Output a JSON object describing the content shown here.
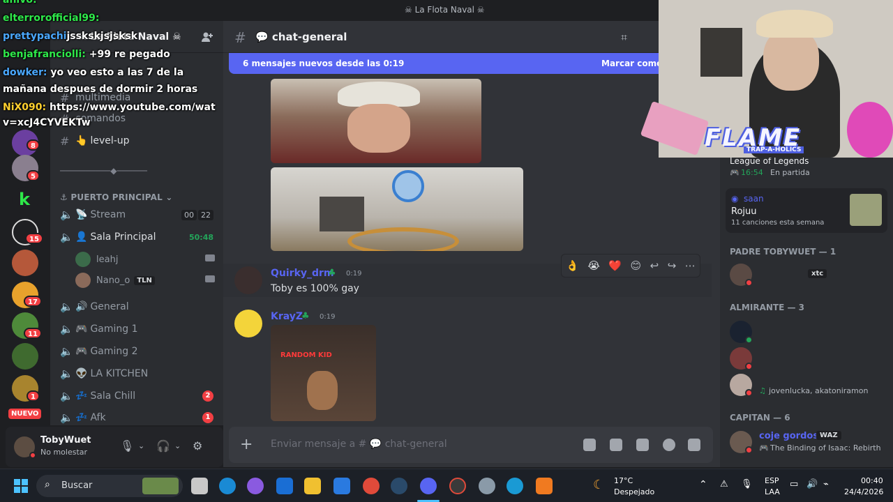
{
  "window": {
    "title": "☠ La Flota Naval ☠"
  },
  "server": {
    "name": "☠ La Flota Naval ☠"
  },
  "server_badges": [
    "8",
    "5",
    "15",
    "17",
    "11",
    "1"
  ],
  "server_nuevo": "NUEVO",
  "channels": [
    {
      "label": "multimedia"
    },
    {
      "label": "comandos"
    },
    {
      "emoji": "👆",
      "label": "level-up"
    }
  ],
  "divider_text": "──────────◆──────",
  "category_puerto": "PUERTO PRINCIPAL",
  "voice_channels": [
    {
      "emoji": "📡",
      "label": "Stream",
      "count_a": "00",
      "count_b": "22"
    },
    {
      "emoji": "👤",
      "label": "Sala Principal",
      "timer": "50:48"
    },
    {
      "emoji": "🔊",
      "label": "General"
    },
    {
      "emoji": "🎮",
      "label": "Gaming 1"
    },
    {
      "emoji": "🎮",
      "label": "Gaming 2"
    },
    {
      "emoji": "👽",
      "label": "LA KITCHEN"
    },
    {
      "emoji": "💤",
      "label": "Sala Chill",
      "badge": "2"
    },
    {
      "emoji": "💤",
      "label": "Afk",
      "badge": "1"
    }
  ],
  "voice_users": [
    {
      "name": "leahj"
    },
    {
      "name": "Nano_o",
      "tag": "TLN"
    }
  ],
  "user_panel": {
    "name": "TobyWuet",
    "status": "No molestar"
  },
  "chat": {
    "channel": "💬 chat-general",
    "new_messages": "6 mensajes nuevos desde las 0:19",
    "mark_read": "Marcar como l",
    "messages": [
      {
        "author": "Quirky_drm",
        "time": "0:19",
        "text": "Toby es 100% gay"
      },
      {
        "author": "KrayZ",
        "time": "0:19",
        "image_caption": "RANDOM KID"
      }
    ],
    "reactions": [
      "👌",
      "😭",
      "❤️",
      "😊",
      "↩",
      "↪",
      "⋯"
    ],
    "composer_placeholder": "Enviar mensaje a # 💬 chat-general"
  },
  "members": {
    "activity_top": {
      "game": "League of Legends",
      "time": "16:54",
      "detail": "En partida"
    },
    "saan": {
      "name": "saan",
      "song": "Rojuu",
      "detail": "11 canciones esta semana"
    },
    "groups": [
      {
        "title": "PADRE TOBYWUET — 1",
        "items": [
          {
            "name": "",
            "tag": "xtc"
          }
        ]
      },
      {
        "title": "ALMIRANTE — 3",
        "items": [
          {
            "name": "",
            "status": ""
          },
          {
            "name": "",
            "status": ""
          },
          {
            "name": "",
            "status": "jovenlucka, akatoniramon"
          }
        ]
      },
      {
        "title": "CAPITAN — 6",
        "items": [
          {
            "name": "coje gordos",
            "tag": "WAZ",
            "status": "The Binding of Isaac: Rebirth"
          }
        ]
      }
    ]
  },
  "overlay_chat": [
    {
      "user": "anivo:",
      "text": ""
    },
    {
      "user": "elterrorofficial99:",
      "text": ""
    },
    {
      "user": "prettypachi",
      "text": "jsskskjsjsksk"
    },
    {
      "user": "benjafranciolli:",
      "text": "+99 re pegado"
    },
    {
      "user": "dowker:",
      "text": "yo veo esto a las 7 de la"
    },
    {
      "user": "",
      "text": "mañana despues de dormir 2 horas"
    },
    {
      "user": "NiX090:",
      "text": "https://www.youtube.com/wat"
    },
    {
      "user": "",
      "text": "v=xcJ4CYVEKTw"
    }
  ],
  "webcam": {
    "logo": "FLAME",
    "logo_sub": "TRAP-A-HOLICS"
  },
  "taskbar": {
    "search_placeholder": "Buscar",
    "weather_temp": "17°C",
    "weather_desc": "Despejado",
    "lang": "ESP",
    "lang2": "LAA",
    "time": "00:40",
    "date": "24/4/2026"
  }
}
